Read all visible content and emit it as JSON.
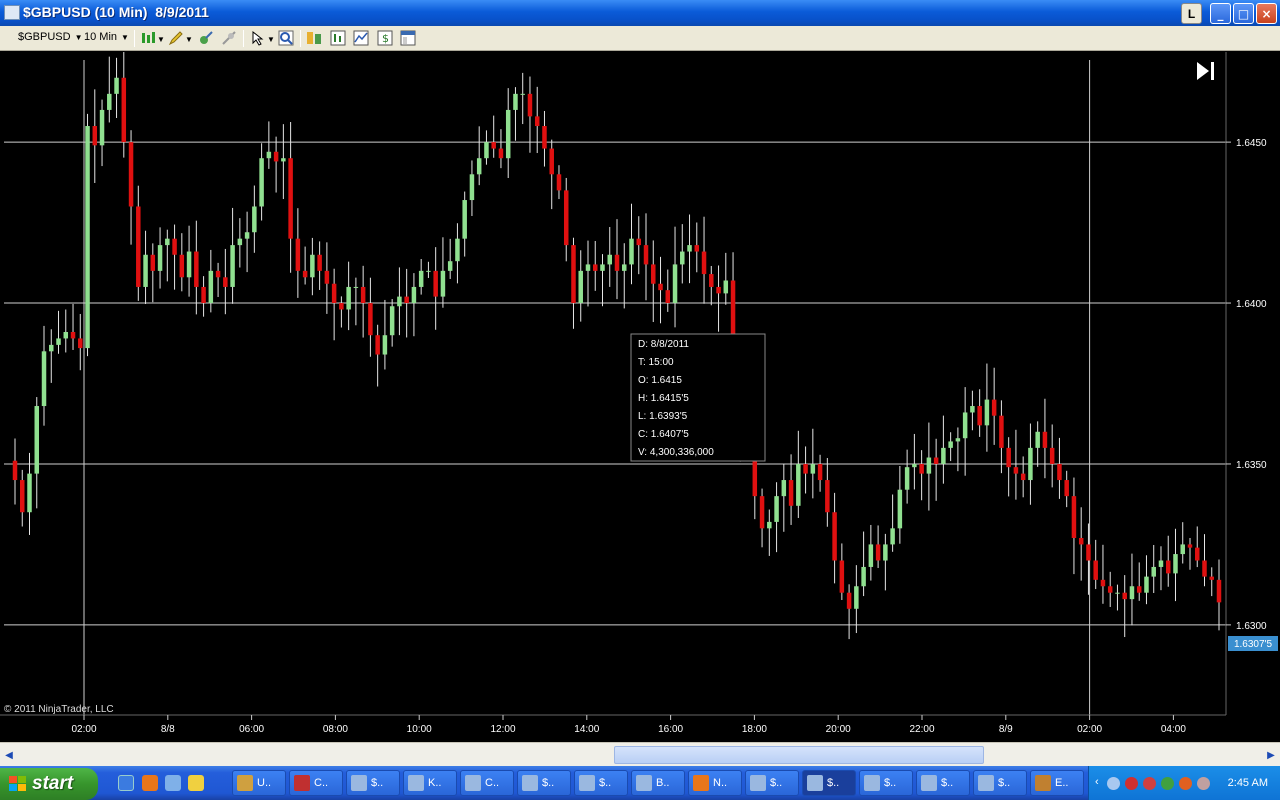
{
  "window": {
    "title": "$GBPUSD (10 Min)  8/9/2011",
    "btn_l": "L",
    "btn_min": "_",
    "btn_max": "□",
    "btn_close": "×"
  },
  "toolbar": {
    "instrument": "$GBPUSD",
    "interval": "10 Min",
    "icons": [
      "candlestick-icon",
      "pencil-icon",
      "crosshair-icon",
      "zoom-icon",
      "pointer-icon",
      "magnifier-icon",
      "bars-icon",
      "data-box-icon",
      "indicator-icon",
      "strategy-icon",
      "properties-icon"
    ]
  },
  "chart_data": {
    "type": "candlestick",
    "y_ticks": [
      "1.6450",
      "1.6400",
      "1.6350",
      "1.6300"
    ],
    "x_ticks": [
      "02:00",
      "8/8",
      "06:00",
      "08:00",
      "10:00",
      "12:00",
      "14:00",
      "16:00",
      "18:00",
      "20:00",
      "22:00",
      "8/9",
      "02:00",
      "04:00"
    ],
    "ylim": [
      1.6272,
      1.6478
    ],
    "grid": true,
    "current_price": "1.6307'5",
    "copyright": "© 2011 NinjaTrader, LLC",
    "colors": {
      "up": "#90e090",
      "down": "#e01010",
      "background": "#000000",
      "grid": "#ffffff"
    },
    "closes": [
      1.6345,
      1.6335,
      1.6347,
      1.6368,
      1.6385,
      1.6387,
      1.6389,
      1.6391,
      1.6389,
      1.6386,
      1.6455,
      1.6449,
      1.646,
      1.6465,
      1.647,
      1.645,
      1.643,
      1.6405,
      1.6415,
      1.641,
      1.6418,
      1.642,
      1.6415,
      1.6408,
      1.6416,
      1.6405,
      1.64,
      1.641,
      1.6408,
      1.6405,
      1.6418,
      1.642,
      1.6422,
      1.643,
      1.6445,
      1.6447,
      1.6444,
      1.6445,
      1.642,
      1.641,
      1.6408,
      1.6415,
      1.641,
      1.6406,
      1.64,
      1.6398,
      1.6405,
      1.6405,
      1.64,
      1.639,
      1.6384,
      1.639,
      1.6399,
      1.6402,
      1.64,
      1.6405,
      1.641,
      1.641,
      1.6402,
      1.641,
      1.6413,
      1.642,
      1.6432,
      1.644,
      1.6445,
      1.645,
      1.6448,
      1.6445,
      1.646,
      1.6465,
      1.6465,
      1.6458,
      1.6455,
      1.6448,
      1.644,
      1.6435,
      1.6418,
      1.64,
      1.641,
      1.6412,
      1.641,
      1.6412,
      1.6415,
      1.641,
      1.6412,
      1.642,
      1.6418,
      1.6412,
      1.6406,
      1.6404,
      1.64,
      1.6412,
      1.6416,
      1.6418,
      1.6416,
      1.6409,
      1.6405,
      1.6403,
      1.6407,
      1.6362,
      1.6358,
      1.6357,
      1.634,
      1.633,
      1.6332,
      1.634,
      1.6345,
      1.6337,
      1.635,
      1.6347,
      1.635,
      1.6345,
      1.6335,
      1.632,
      1.631,
      1.6305,
      1.6312,
      1.6318,
      1.6325,
      1.632,
      1.6325,
      1.633,
      1.6342,
      1.6349,
      1.635,
      1.6347,
      1.6352,
      1.635,
      1.6355,
      1.6357,
      1.6358,
      1.6366,
      1.6368,
      1.6362,
      1.637,
      1.6365,
      1.6355,
      1.6349,
      1.6347,
      1.6345,
      1.6355,
      1.636,
      1.6355,
      1.635,
      1.6345,
      1.634,
      1.6327,
      1.6325,
      1.632,
      1.6314,
      1.6312,
      1.631,
      1.631,
      1.6308,
      1.6312,
      1.631,
      1.6315,
      1.6318,
      1.632,
      1.6316,
      1.6322,
      1.6325,
      1.6324,
      1.632,
      1.6315,
      1.6314,
      1.6307
    ]
  },
  "tooltip": {
    "date": "D: 8/8/2011",
    "time": "T: 15:00",
    "open": "O: 1.6415",
    "high": "H: 1.6415'5",
    "low": "L: 1.6393'5",
    "close": "C: 1.6407'5",
    "volume": "V: 4,300,336,000"
  },
  "taskbar": {
    "start": "start",
    "tasks": [
      "U..",
      "C..",
      "$..",
      "K..",
      "C..",
      "$..",
      "$..",
      "B..",
      "N..",
      "$..",
      "$..",
      "$..",
      "$..",
      "$..",
      "E.."
    ],
    "clock": "2:45 AM"
  }
}
